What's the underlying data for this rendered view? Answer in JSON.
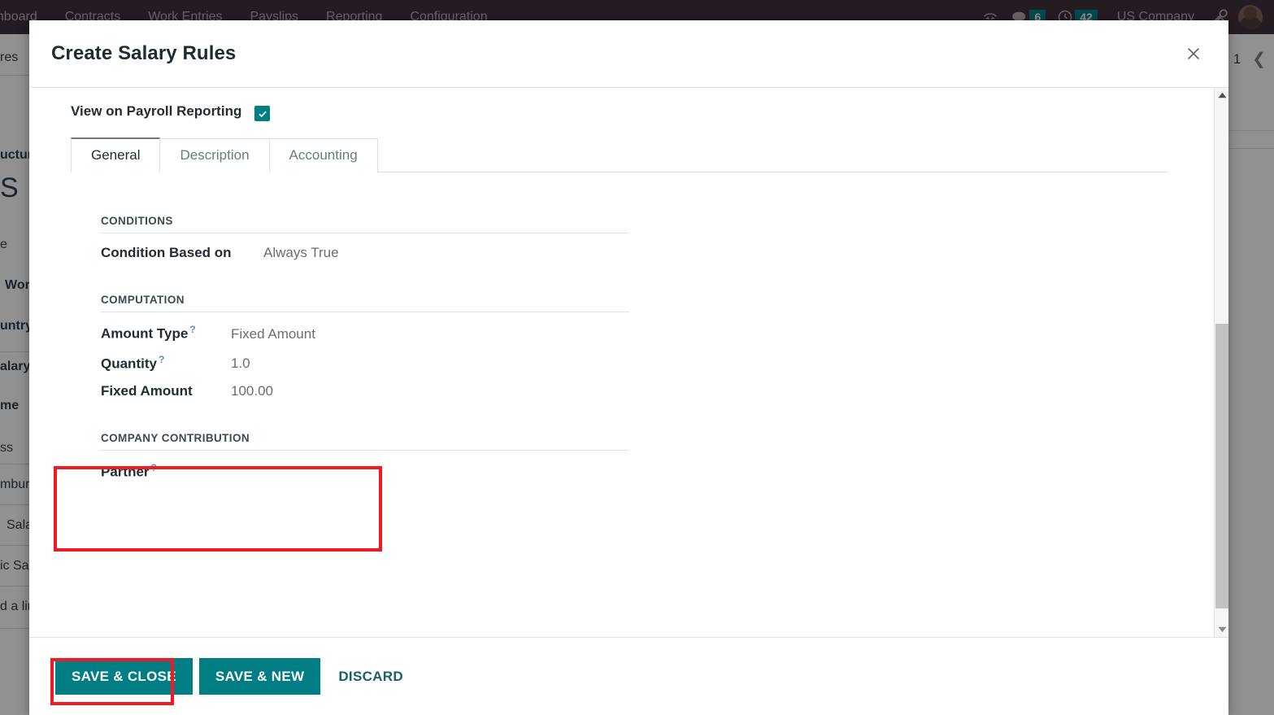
{
  "navbar": {
    "menu_items": [
      "ashboard",
      "Contracts",
      "Work Entries",
      "Payslips",
      "Reporting",
      "Configuration"
    ],
    "phone_icon": "phone-icon",
    "chat_icon": "chat-bubble-icon",
    "chat_count": "6",
    "activity_icon": "clock-icon",
    "activity_count": "42",
    "company": "US Company",
    "debug_icon": "wrench-icon",
    "avatar": "user-avatar",
    "background_color": "#3b2b38",
    "badge_color": "#017e84"
  },
  "background": {
    "left_fragments": [
      "res",
      "ucture",
      "S",
      "e",
      "Wor",
      "untry",
      "alary",
      "me",
      "ss",
      "mbur",
      "Sala",
      "ic Sal",
      "d a lin"
    ],
    "pager_value": "1",
    "pager_prev_icon": "chevron-left-icon"
  },
  "dialog": {
    "title": "Create Salary Rules",
    "close_icon": "close-icon",
    "top_field": {
      "label": "View on Payroll Reporting",
      "checked": true,
      "checkbox_color": "#017e84"
    },
    "tabs": [
      {
        "label": "General",
        "active": true
      },
      {
        "label": "Description",
        "active": false
      },
      {
        "label": "Accounting",
        "active": false
      }
    ],
    "sections": [
      {
        "title": "CONDITIONS",
        "rows": [
          {
            "label": "Condition Based on",
            "help": false,
            "value": "Always True"
          }
        ]
      },
      {
        "title": "COMPUTATION",
        "rows": [
          {
            "label": "Amount Type",
            "help": true,
            "value": "Fixed Amount"
          },
          {
            "label": "Quantity",
            "help": true,
            "value": "1.0"
          },
          {
            "label": "Fixed Amount",
            "help": false,
            "value": "100.00"
          }
        ]
      },
      {
        "title": "COMPANY CONTRIBUTION",
        "rows": [
          {
            "label": "Partner",
            "help": true,
            "value": ""
          }
        ]
      }
    ],
    "scrollbar": {
      "up_icon": "scroll-up-arrow-icon",
      "down_icon": "scroll-down-arrow-icon"
    },
    "footer": {
      "save_close_label": "SAVE & CLOSE",
      "save_new_label": "SAVE & NEW",
      "discard_label": "DISCARD",
      "primary_color": "#017e84"
    },
    "annotations": {
      "highlight_color": "#ee1b24",
      "field_box_targets": [
        "Quantity",
        "Fixed Amount"
      ],
      "button_box_target": "SAVE & CLOSE"
    }
  }
}
